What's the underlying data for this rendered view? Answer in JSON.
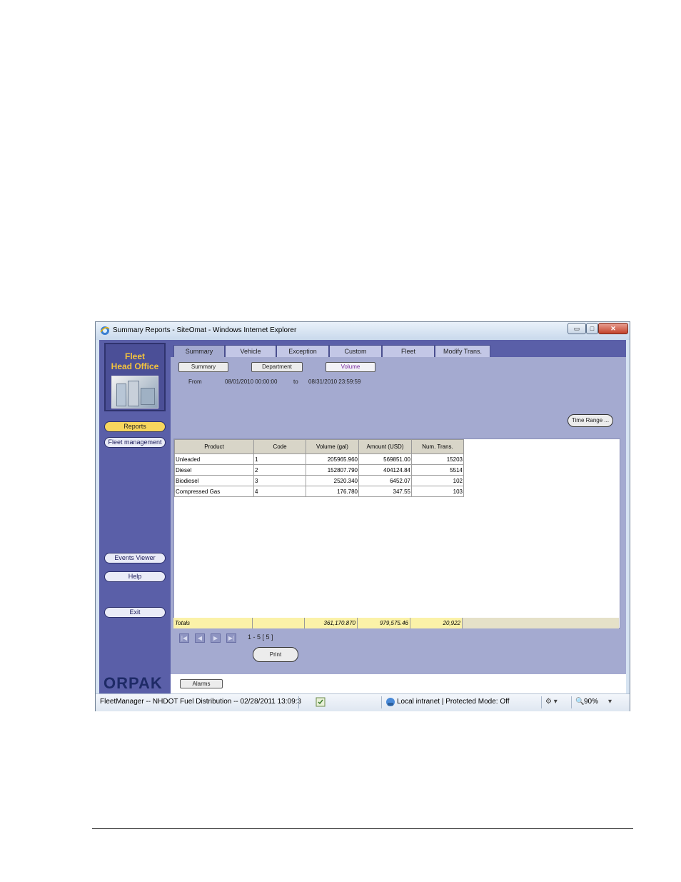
{
  "window": {
    "title": "Summary Reports - SiteOmat - Windows Internet Explorer",
    "controls": {
      "minimize": "▭",
      "maximize": "□",
      "close": "✕"
    }
  },
  "sidebar": {
    "logo_line1": "Fleet",
    "logo_line2": "Head Office",
    "brand": "ORPAK",
    "buttons": {
      "reports": "Reports",
      "fleet_management": "Fleet management",
      "events_viewer": "Events Viewer",
      "help": "Help",
      "exit": "Exit"
    }
  },
  "tabs": [
    "Summary",
    "Vehicle",
    "Exception",
    "Custom",
    "Fleet",
    "Modify Trans."
  ],
  "report_buttons": {
    "summary": "Summary",
    "department": "Department",
    "volume": "Volume"
  },
  "date_range": {
    "from_label": "From",
    "from": "08/01/2010 00:00:00",
    "to_label": "to",
    "to": "08/31/2010 23:59:59"
  },
  "time_range_button": "Time Range ...",
  "grid": {
    "headers": [
      "Product",
      "Code",
      "Volume (gal)",
      "Amount (USD)",
      "Num. Trans."
    ],
    "rows": [
      [
        "Unleaded",
        "1",
        "205965.960",
        "569851.00",
        "15203"
      ],
      [
        "Diesel",
        "2",
        "152807.790",
        "404124.84",
        "5514"
      ],
      [
        "Biodiesel",
        "3",
        "2520.340",
        "6452.07",
        "102"
      ],
      [
        "Compressed Gas",
        "4",
        "176.780",
        "347.55",
        "103"
      ]
    ],
    "totals": [
      "Totals",
      "",
      "361,170.870",
      "979,575.46",
      "20,922"
    ]
  },
  "pager": {
    "info": "1 - 5  [ 5 ]",
    "first": "|◀",
    "prev": "◀",
    "next": "▶",
    "last": "▶|"
  },
  "print_button": "Print",
  "alarms_button": "Alarms",
  "status_bar": {
    "text": "FleetManager -- NHDOT Fuel Distribution -- 02/28/2011  13:09:3",
    "zone": "Local intranet | Protected Mode: Off",
    "zoom": "90%"
  }
}
